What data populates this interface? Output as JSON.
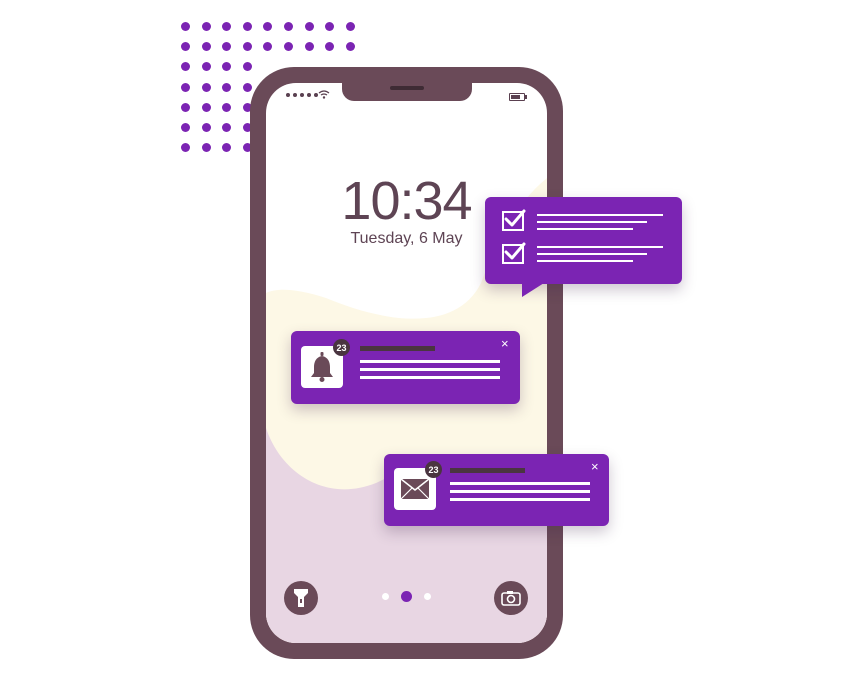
{
  "lock_screen": {
    "time": "10:34",
    "date": "Tuesday, 6 May"
  },
  "notifications": [
    {
      "icon": "bell-icon",
      "badge": "23",
      "close": "×"
    },
    {
      "icon": "mail-icon",
      "badge": "23",
      "close": "×"
    }
  ],
  "checklist": {
    "items": [
      {
        "checked": true
      },
      {
        "checked": true
      }
    ]
  },
  "pager": {
    "pages": 3,
    "active": 2
  },
  "colors": {
    "accent": "#7b24b3",
    "phone_frame": "#6a4a58",
    "wallpaper_cream": "#fdf8e6",
    "wallpaper_mauve": "#e8d6e3"
  }
}
